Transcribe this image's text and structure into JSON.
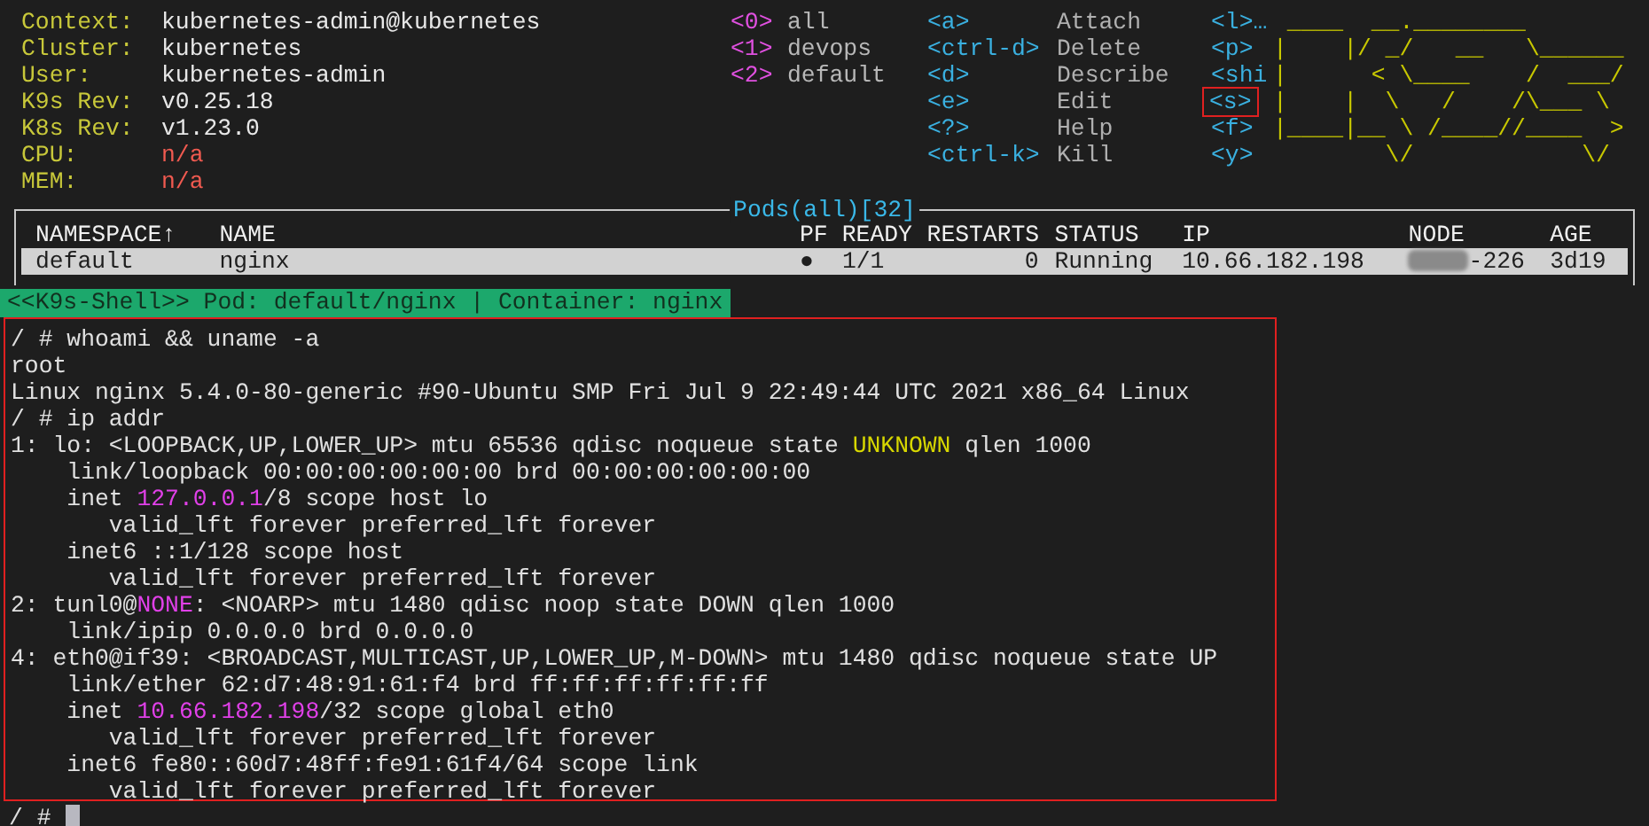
{
  "context_info": [
    {
      "label": "Context:",
      "value": "kubernetes-admin@kubernetes",
      "kind": "plain"
    },
    {
      "label": "Cluster:",
      "value": "kubernetes",
      "kind": "plain"
    },
    {
      "label": "User:",
      "value": "kubernetes-admin",
      "kind": "plain"
    },
    {
      "label": "K9s Rev:",
      "value": "v0.25.18",
      "kind": "plain"
    },
    {
      "label": "K8s Rev:",
      "value": "v1.23.0",
      "kind": "plain"
    },
    {
      "label": "CPU:",
      "value": "n/a",
      "kind": "unavailable"
    },
    {
      "label": "MEM:",
      "value": "n/a",
      "kind": "unavailable"
    }
  ],
  "namespaces": [
    {
      "key": "<0>",
      "name": "all"
    },
    {
      "key": "<1>",
      "name": "devops"
    },
    {
      "key": "<2>",
      "name": "default"
    }
  ],
  "shortcuts": [
    {
      "key": "<a>",
      "action": "Attach"
    },
    {
      "key": "<ctrl-d>",
      "action": "Delete"
    },
    {
      "key": "<d>",
      "action": "Describe"
    },
    {
      "key": "<e>",
      "action": "Edit"
    },
    {
      "key": "<?>",
      "action": "Help"
    },
    {
      "key": "<ctrl-k>",
      "action": "Kill"
    }
  ],
  "extra_shortcuts": [
    {
      "key": "<l>…",
      "boxed": false
    },
    {
      "key": "<p>",
      "boxed": false
    },
    {
      "key": "<shi",
      "boxed": false
    },
    {
      "key": "<s>",
      "boxed": true
    },
    {
      "key": "<f>",
      "boxed": false
    },
    {
      "key": "<y>",
      "boxed": false
    }
  ],
  "logo": [
    " ____  __.________       ",
    "|    |/ _/   __   \\______ ",
    "|      < \\____    /  ___/ ",
    "|    |  \\   /    /\\___ \\  ",
    "|____|__ \\ /____//____  > ",
    "        \\/            \\/  "
  ],
  "pods": {
    "title": "Pods(all)[32]",
    "columns": [
      "NAMESPACE↑",
      "NAME",
      "PF",
      "READY",
      "RESTARTS",
      "STATUS",
      "IP",
      "NODE",
      "AGE"
    ],
    "rows": [
      {
        "cells": [
          "default",
          "nginx",
          "●",
          "1/1",
          "0",
          "Running",
          "10.66.182.198",
          "-226",
          "3d19"
        ],
        "selected": true
      }
    ]
  },
  "shell": {
    "banner": "<<K9s-Shell>> Pod: default/nginx | Container: nginx",
    "framed": true,
    "lines": [
      [
        {
          "text": "/ # whoami && uname -a",
          "kind": "plain"
        }
      ],
      [
        {
          "text": "root",
          "kind": "plain"
        }
      ],
      [
        {
          "text": "Linux nginx 5.4.0-80-generic #90-Ubuntu SMP Fri Jul 9 22:49:44 UTC 2021 x86_64 Linux",
          "kind": "plain"
        }
      ],
      [
        {
          "text": "/ # ip addr",
          "kind": "plain"
        }
      ],
      [
        {
          "text": "1: lo: <LOOPBACK,UP,LOWER_UP> mtu 65536 qdisc noqueue state ",
          "kind": "plain"
        },
        {
          "text": "UNKNOWN",
          "kind": "state"
        },
        {
          "text": " qlen 1000",
          "kind": "plain"
        }
      ],
      [
        {
          "text": "    link/loopback 00:00:00:00:00:00 brd 00:00:00:00:00:00",
          "kind": "plain"
        }
      ],
      [
        {
          "text": "    inet ",
          "kind": "plain"
        },
        {
          "text": "127.0.0.1",
          "kind": "address"
        },
        {
          "text": "/8 scope host lo",
          "kind": "plain"
        }
      ],
      [
        {
          "text": "       valid_lft forever preferred_lft forever",
          "kind": "plain"
        }
      ],
      [
        {
          "text": "    inet6 ::1/128 scope host",
          "kind": "plain"
        }
      ],
      [
        {
          "text": "       valid_lft forever preferred_lft forever",
          "kind": "plain"
        }
      ],
      [
        {
          "text": "2: tunl0@",
          "kind": "plain"
        },
        {
          "text": "NONE",
          "kind": "address"
        },
        {
          "text": ": <NOARP> mtu 1480 qdisc noop state DOWN qlen 1000",
          "kind": "plain"
        }
      ],
      [
        {
          "text": "    link/ipip 0.0.0.0 brd 0.0.0.0",
          "kind": "plain"
        }
      ],
      [
        {
          "text": "4: eth0@if39: <BROADCAST,MULTICAST,UP,LOWER_UP,M-DOWN> mtu 1480 qdisc noqueue state UP",
          "kind": "plain"
        }
      ],
      [
        {
          "text": "    link/ether 62:d7:48:91:61:f4 brd ff:ff:ff:ff:ff:ff",
          "kind": "plain"
        }
      ],
      [
        {
          "text": "    inet ",
          "kind": "plain"
        },
        {
          "text": "10.66.182.198",
          "kind": "address"
        },
        {
          "text": "/32 scope global eth0",
          "kind": "plain"
        }
      ],
      [
        {
          "text": "       valid_lft forever preferred_lft forever",
          "kind": "plain"
        }
      ],
      [
        {
          "text": "    inet6 fe80::60d7:48ff:fe91:61f4/64 scope link",
          "kind": "plain"
        }
      ],
      [
        {
          "text": "       valid_lft forever preferred_lft forever",
          "kind": "plain"
        }
      ]
    ],
    "prompt": "/ #"
  }
}
